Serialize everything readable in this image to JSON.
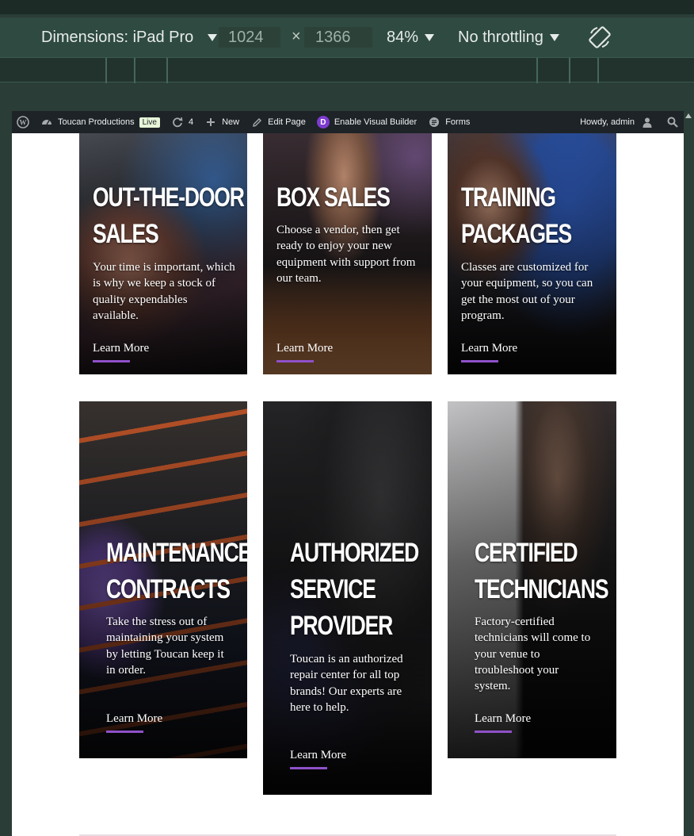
{
  "devtools": {
    "device_label": "Dimensions: iPad Pro",
    "width": "1024",
    "times": "×",
    "height": "1366",
    "zoom": "84%",
    "throttle": "No throttling"
  },
  "adminbar": {
    "site_name": "Toucan Productions",
    "live_badge": "Live",
    "updates_count": "4",
    "new_label": "New",
    "edit_label": "Edit Page",
    "visual_builder_label": "Enable Visual Builder",
    "divi_letter": "D",
    "forms_label": "Forms",
    "howdy": "Howdy, admin"
  },
  "cards": [
    {
      "title_line1": "OUT-THE-DOOR",
      "title_line2": "SALES",
      "description": "Your time is important, which is why we keep a stock of quality expendables available.",
      "link": "Learn More"
    },
    {
      "title_line1": "BOX SALES",
      "description": "Choose a vendor, then get ready to enjoy your new equipment with support from our team.",
      "link": "Learn More"
    },
    {
      "title_line1": "TRAINING",
      "title_line2": "PACKAGES",
      "description": "Classes are customized for your equipment, so you can get the most out of your program.",
      "link": "Learn More"
    },
    {
      "title_line1": "MAINTENANCE",
      "title_line2": "CONTRACTS",
      "description": "Take the stress out of maintaining your system by letting Toucan keep it in order.",
      "link": "Learn More"
    },
    {
      "title_line1": "AUTHORIZED",
      "title_line2": "SERVICE",
      "title_line3": "PROVIDER",
      "description": "Toucan is an authorized repair center for all top brands! Our experts are here to help.",
      "link": "Learn More"
    },
    {
      "title_line1": "CERTIFIED",
      "title_line2": "TECHNICIANS",
      "description": "Factory-certified technicians will come to your venue to troubleshoot your system.",
      "link": "Learn More"
    }
  ],
  "colors": {
    "accent": "#8f51c9",
    "devtools_bg": "#2f4a40",
    "adminbar_bg": "#1d2327"
  },
  "icons": [
    "wordpress-icon",
    "dashboard-icon",
    "refresh-icon",
    "plus-icon",
    "pencil-icon",
    "forms-icon",
    "user-icon",
    "search-icon",
    "rotate-icon"
  ]
}
